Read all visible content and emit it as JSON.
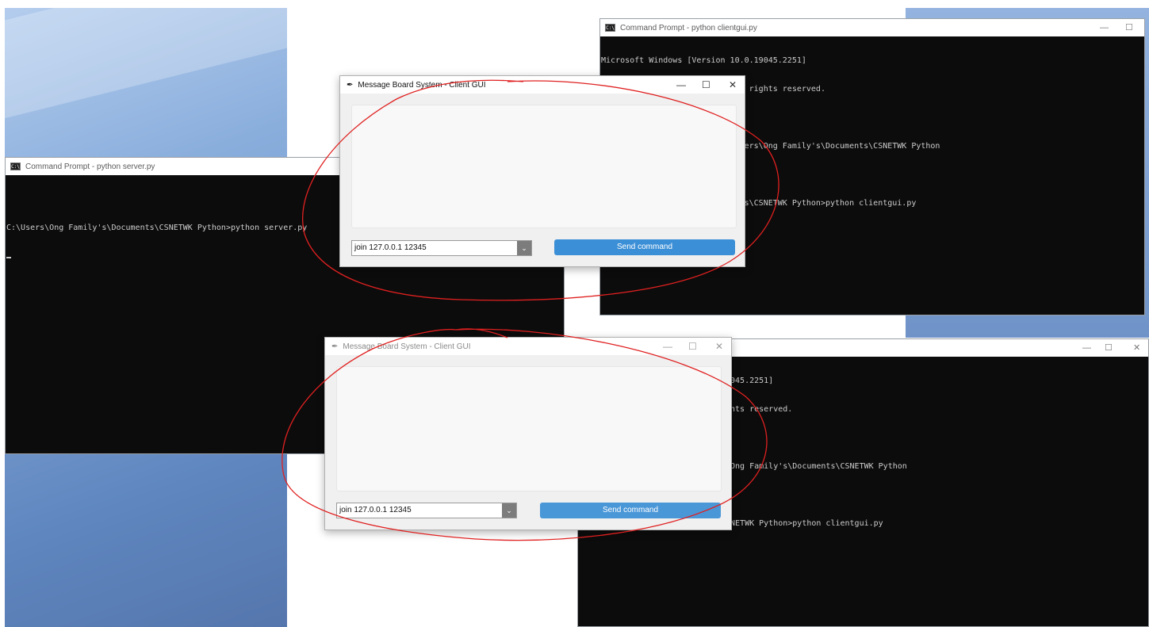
{
  "desktop": {
    "server_cmd": {
      "title": "Command Prompt - python  server.py",
      "lines": [
        "",
        "C:\\Users\\Ong Family's\\Documents\\CSNETWK Python>python server.py"
      ]
    },
    "client_cmd_top": {
      "title": "Command Prompt - python  clientgui.py",
      "lines": [
        "Microsoft Windows [Version 10.0.19045.2251]",
        "(c) Microsoft Corporation. All rights reserved.",
        "",
        "C:\\Users\\Ong Family's>cd C:\\Users\\Ong Family's\\Documents\\CSNETWK Python",
        "",
        "C:\\Users\\Ong Family's\\Documents\\CSNETWK Python>python clientgui.py"
      ]
    },
    "client_cmd_bottom": {
      "lines": [
        "9045.2251]",
        "ghts reserved.",
        "",
        "\\Ong Family's\\Documents\\CSNETWK Python",
        "",
        "SNETWK Python>python clientgui.py"
      ]
    },
    "client_gui_top": {
      "title": "Message Board System - Client GUI",
      "command_value": "join 127.0.0.1 12345",
      "send_label": "Send command"
    },
    "client_gui_bottom": {
      "title": "Message Board System - Client GUI",
      "command_value": "join 127.0.0.1 12345",
      "send_label": "Send command"
    },
    "window_controls": {
      "minimize": "—",
      "maximize": "☐",
      "close": "✕"
    },
    "annotation_color": "#e02020"
  }
}
